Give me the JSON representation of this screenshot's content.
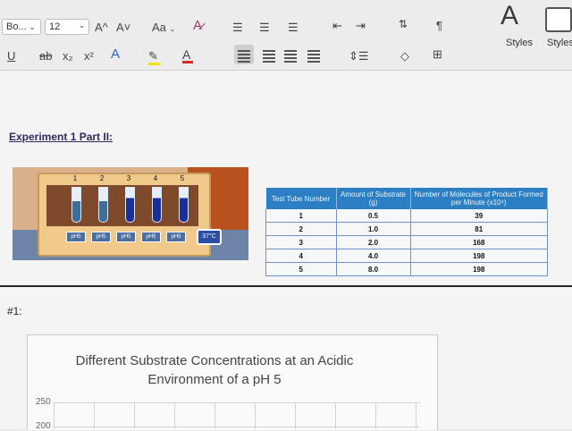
{
  "ribbon": {
    "font_name": "Bo...",
    "font_size": "12",
    "grow_font": "A^",
    "shrink_font": "A˅",
    "change_case": "Aa",
    "paragraph_mark": "¶",
    "styles_label": "Styles",
    "styles_pane_label": "Styles Pane",
    "underline": "U",
    "strikethrough": "ab",
    "subscript": "x₂",
    "superscript": "x²",
    "text_effects_label": "A",
    "font_color_label": "A",
    "font_color": "#d62b2b",
    "highlight_color": "#f2e21a"
  },
  "document": {
    "heading": "Experiment 1 Part II:",
    "question_label": "#1:"
  },
  "lab_image": {
    "tube_numbers": [
      "1",
      "2",
      "3",
      "4",
      "5"
    ],
    "ph_labels": [
      "pH5",
      "pH5",
      "pH5",
      "pH5",
      "pH5"
    ],
    "temperature": "37°C"
  },
  "table": {
    "headers": [
      "Test Tube Number",
      "Amount of Substrate (g)",
      "Number of Molecules of Product Formed per Minute (x10⁴)"
    ],
    "rows": [
      [
        "1",
        "0.5",
        "39"
      ],
      [
        "2",
        "1.0",
        "81"
      ],
      [
        "3",
        "2.0",
        "168"
      ],
      [
        "4",
        "4.0",
        "198"
      ],
      [
        "5",
        "8.0",
        "198"
      ]
    ]
  },
  "chart": {
    "title_line1": "Different Substrate Concentrations at an Acidic",
    "title_line2": "Environment of a pH 5",
    "ytick_top": "250",
    "ytick_next": "200"
  }
}
